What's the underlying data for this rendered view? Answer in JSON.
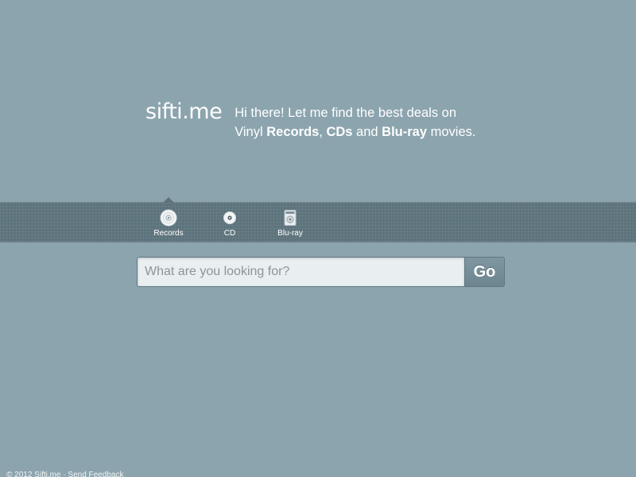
{
  "brand": {
    "logo_text": "sifti.me"
  },
  "tagline": {
    "line1": "Hi there! Let me find the best deals on",
    "line2_prefix": "Vinyl ",
    "records": "Records",
    "sep1": ", ",
    "cds": "CDs",
    "sep2": " and ",
    "bluray": "Blu-ray",
    "suffix": " movies."
  },
  "categories": [
    {
      "label": "Records",
      "icon": "record-icon",
      "selected": true
    },
    {
      "label": "CD",
      "icon": "cd-icon",
      "selected": false
    },
    {
      "label": "Blu-ray",
      "icon": "bluray-icon",
      "selected": false
    }
  ],
  "search": {
    "placeholder": "What are you looking for?",
    "value": "",
    "go_label": "Go"
  },
  "footer": {
    "copyright": "© 2012 Sifti.me",
    "separator": " · ",
    "feedback_link": "Send Feedback"
  },
  "colors": {
    "background": "#8ca4ae",
    "category_bar": "#5d737c",
    "input_bg": "#e9eef0",
    "go_button": "#758e98"
  }
}
